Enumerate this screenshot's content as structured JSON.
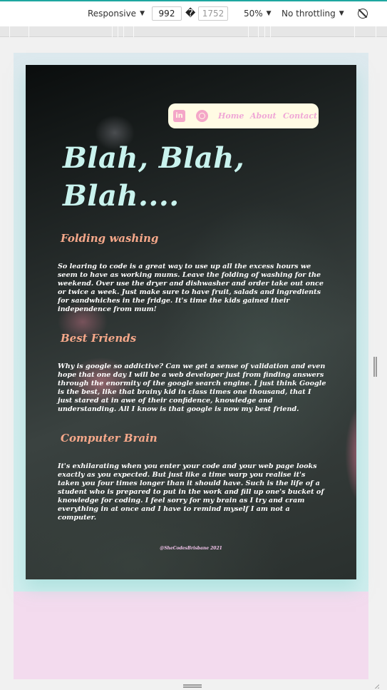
{
  "devtools": {
    "device_label": "Responsive",
    "width_value": "992",
    "dimension_separator": "�",
    "height_placeholder": "1752",
    "zoom_label": "50%",
    "throttling_label": "No throttling",
    "rotate_icon": "rotate-icon"
  },
  "page": {
    "nav": {
      "linkedin_icon": "linkedin-icon",
      "linkedin_glyph": "in",
      "dribbble_icon": "dribbble-icon",
      "links": [
        "Home",
        "About",
        "Contact"
      ]
    },
    "hero_title": "Blah, Blah, Blah....",
    "sections": [
      {
        "heading": "Folding washing",
        "body": "So learing to code is a great way to use up all the excess hours we seem to have as working mums. Leave the folding of washing for the weekend. Over use the dryer and dishwasher and order take out once or twice a week. Just make sure to have fruit, salads and ingredients for sandwhiches in the fridge. It's time the kids gained their independence from mum!"
      },
      {
        "heading": "Best Friends",
        "body": "Why is google so addictive? Can we get a sense of validation and even hope that one day I will be a web developer just from finding answers through the enormity of the google search engine. I just think Google is the best, like that brainy kid in class times one thousand, that I just stared at in awe of their confidence, knowledge and understanding. All I know is that google is now my best friend."
      },
      {
        "heading": "Computer Brain",
        "body": "It's exhilarating when you enter your code and your web page looks exactly as you expected. But just like a time warp you realise it's taken you four times longer than it should have. Such is the life of a student who is prepared to put in the work and fill up one's bucket of knowledge for coding. I feel sorry for my brain as I try and cram everything in at once and I have to remind myself I am not a computer."
      }
    ],
    "footer": "@SheCodesBrisbane 2021"
  },
  "colors": {
    "title": "#c9f3ee",
    "heading": "#f6a88a",
    "nav_bg": "#fffbe4",
    "nav_link": "#f0a8d6",
    "page_bg": "#f3dbee"
  }
}
